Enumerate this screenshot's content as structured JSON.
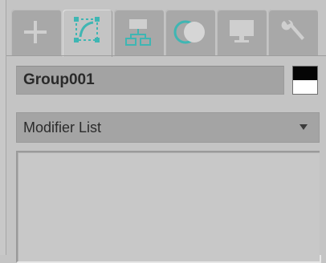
{
  "command_panel": {
    "tabs": [
      {
        "icon": "create-icon",
        "label": "Create"
      },
      {
        "icon": "modify-icon",
        "label": "Modify",
        "active": true
      },
      {
        "icon": "hierarchy-icon",
        "label": "Hierarchy"
      },
      {
        "icon": "motion-icon",
        "label": "Motion"
      },
      {
        "icon": "display-icon",
        "label": "Display"
      },
      {
        "icon": "utilities-icon",
        "label": "Utilities"
      }
    ],
    "object_name": "Group001",
    "object_color": {
      "top": "#000000",
      "bottom": "#ffffff"
    },
    "modifier_list": {
      "label": "Modifier List",
      "arrow_icon": "chevron-down-icon"
    },
    "colors": {
      "accent_icon": "#3fb6b3",
      "panel_bg": "#c4c4c4",
      "tab_bg": "#a8a8a8"
    }
  }
}
